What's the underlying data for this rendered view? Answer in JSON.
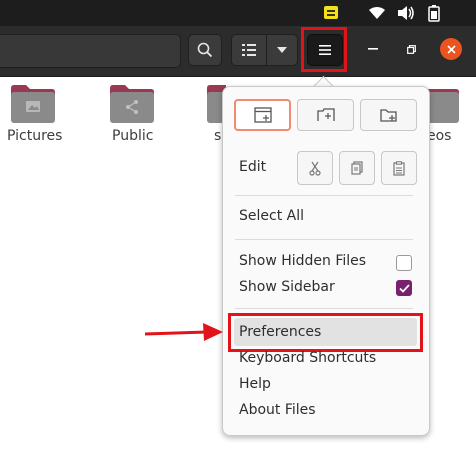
{
  "folders": [
    {
      "label": "Pictures"
    },
    {
      "label": "Public"
    },
    {
      "label": "s"
    },
    {
      "label": "eos"
    }
  ],
  "menu": {
    "edit_label": "Edit",
    "select_all": "Select All",
    "show_hidden_files": {
      "label": "Show Hidden Files",
      "checked": false
    },
    "show_sidebar": {
      "label": "Show Sidebar",
      "checked": true
    },
    "preferences": "Preferences",
    "keyboard_shortcuts": "Keyboard Shortcuts",
    "help": "Help",
    "about_files": "About Files"
  },
  "colors": {
    "highlight_red": "#e1141c",
    "accent_purple": "#77216f",
    "close_orange": "#e95420",
    "folder_body": "#8a8a8a",
    "folder_tab": "#9a3a52"
  },
  "icons": {
    "tray": [
      "sticky-note-icon",
      "wifi-icon",
      "volume-icon",
      "battery-icon"
    ],
    "header": [
      "search-icon",
      "list-view-icon",
      "chevron-down-icon",
      "hamburger-menu-icon",
      "minimize-icon",
      "maximize-icon",
      "close-icon"
    ],
    "popover_buttons": [
      "new-window-icon",
      "new-tab-icon",
      "new-folder-icon",
      "cut-icon",
      "copy-icon",
      "paste-icon"
    ]
  }
}
